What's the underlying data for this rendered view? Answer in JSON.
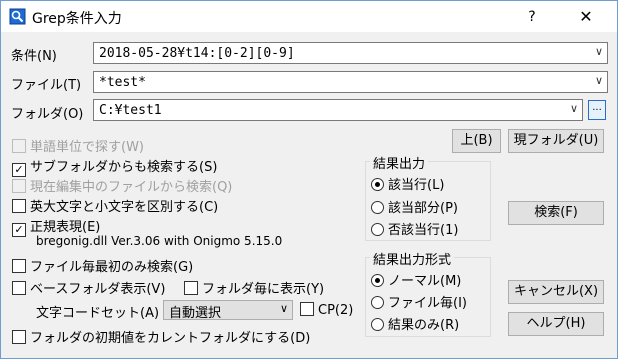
{
  "window": {
    "title": "Grep条件入力",
    "help_label": "?",
    "close_label": "✕"
  },
  "condition": {
    "label": "条件(N)",
    "value": "2018-05-28¥t14:[0-2][0-9]"
  },
  "file": {
    "label": "ファイル(T)",
    "value": "*test*"
  },
  "folder": {
    "label": "フォルダ(O)",
    "value": "C:¥test1",
    "browse_label": "..."
  },
  "buttons": {
    "up": "上(B)",
    "current_folder": "現フォルダ(U)",
    "search": "検索(F)",
    "cancel": "キャンセル(X)",
    "help": "ヘルプ(H)"
  },
  "options": {
    "word_unit": {
      "label": "単語単位で探す(W)",
      "checked": false,
      "disabled": true
    },
    "subfolders": {
      "label": "サブフォルダからも検索する(S)",
      "checked": true
    },
    "current_file": {
      "label": "現在編集中のファイルから検索(Q)",
      "checked": false,
      "disabled": true
    },
    "case_sensitive": {
      "label": "英大文字と小文字を区別する(C)",
      "checked": false
    },
    "regex": {
      "label": "正規表現(E)",
      "checked": true
    },
    "regex_info": "bregonig.dll Ver.3.06 with Onigmo 5.15.0",
    "first_match_only": {
      "label": "ファイル毎最初のみ検索(G)",
      "checked": false
    },
    "base_folder": {
      "label": "ベースフォルダ表示(V)",
      "checked": false
    },
    "per_folder": {
      "label": "フォルダ毎に表示(Y)",
      "checked": false
    },
    "encoding_label": "文字コードセット(A)",
    "encoding_value": "自動選択",
    "cp": {
      "label": "CP(2)",
      "checked": false
    },
    "default_folder": {
      "label": "フォルダの初期値をカレントフォルダにする(D)",
      "checked": false
    }
  },
  "result_output": {
    "title": "結果出力",
    "options": [
      "該当行(L)",
      "該当部分(P)",
      "否該当行(1)"
    ],
    "selected": 0
  },
  "result_format": {
    "title": "結果出力形式",
    "options": [
      "ノーマル(M)",
      "ファイル毎(I)",
      "結果のみ(R)"
    ],
    "selected": 0
  },
  "check_mark": "✓",
  "arrow": "∨"
}
